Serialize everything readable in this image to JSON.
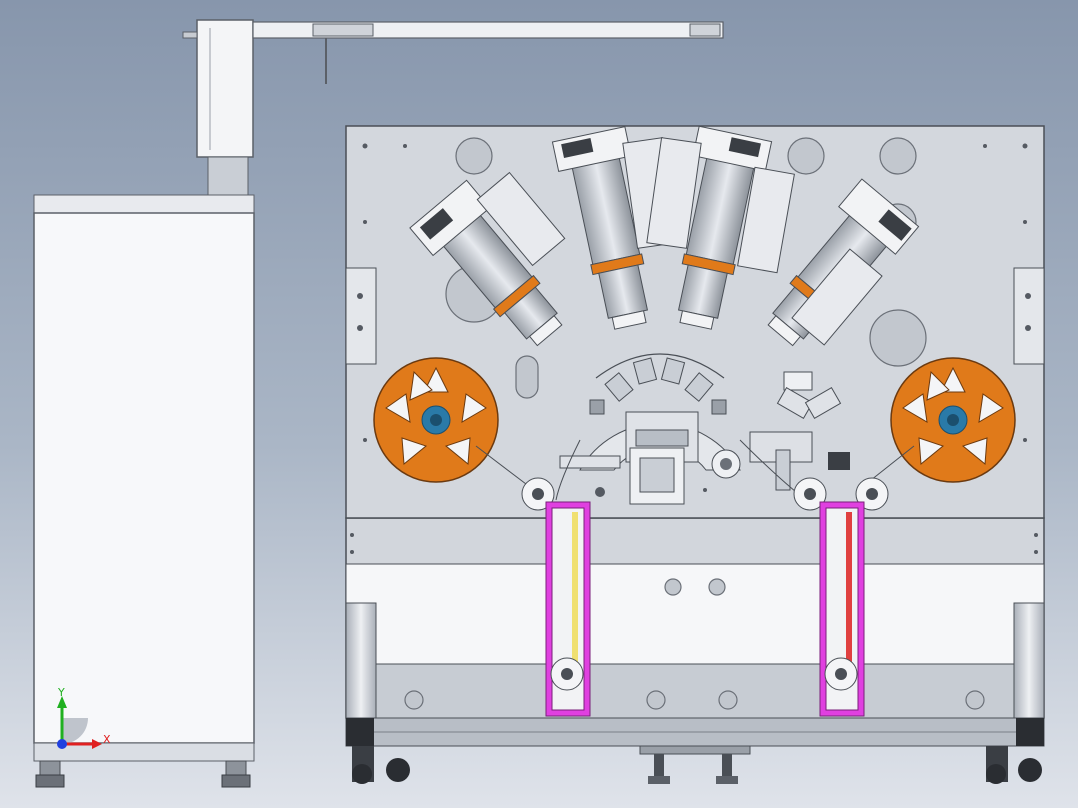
{
  "viewport": {
    "background_top": "#8796ac",
    "background_bottom": "#dfe3ea"
  },
  "model": {
    "frame_color": "#d9dde4",
    "panel_color": "#c8cdd5",
    "reel_color": "#e07a1a",
    "hub_color": "#2a7aa8",
    "accent_magenta": "#e040e0",
    "accent_orange": "#e07a1a"
  },
  "triad": {
    "x_label": "X",
    "y_label": "Y",
    "x_color": "#e02020",
    "y_color": "#20b020",
    "z_color": "#2040e0"
  }
}
